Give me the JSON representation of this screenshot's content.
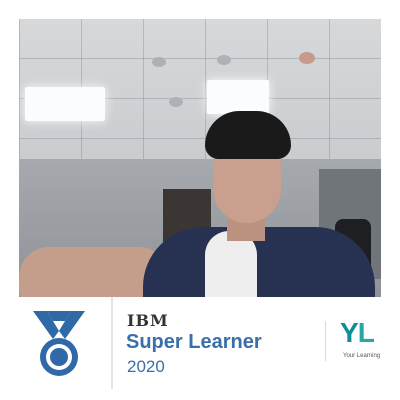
{
  "badge": {
    "brand": "IBM",
    "title": "Super Learner",
    "year": "2020"
  },
  "logo": {
    "mark_y": "Y",
    "mark_l": "L",
    "caption": "Your Learning"
  },
  "colors": {
    "accent_blue": "#3a6fa9",
    "logo_teal": "#0f8f8f",
    "medal_blue": "#2f6aa6"
  },
  "icons": {
    "medal": "medal-icon"
  }
}
